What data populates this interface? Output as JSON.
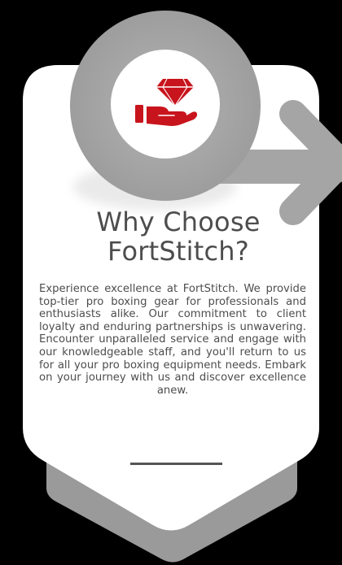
{
  "heading": {
    "line1": "Why Choose",
    "line2": "FortStitch?"
  },
  "description": "Experience excellence at FortStitch. We provide top-tier pro boxing gear for professionals and enthusiasts alike. Our commitment to client loyalty and enduring partnerships is unwavering. Encounter unparalleled service and engage with our knowledgeable staff, and you'll return to us for all your pro boxing equipment needs. Embark on your journey with us and discover excellence anew.",
  "icons": {
    "main": "hand-holding-diamond-icon",
    "arrow": "arrow-right-icon"
  },
  "colors": {
    "background": "#000000",
    "card": "#ffffff",
    "shadow": "#9a9a9a",
    "circle": "#a5a5a5",
    "accent": "#c8141c",
    "text": "#4d4d4d"
  }
}
